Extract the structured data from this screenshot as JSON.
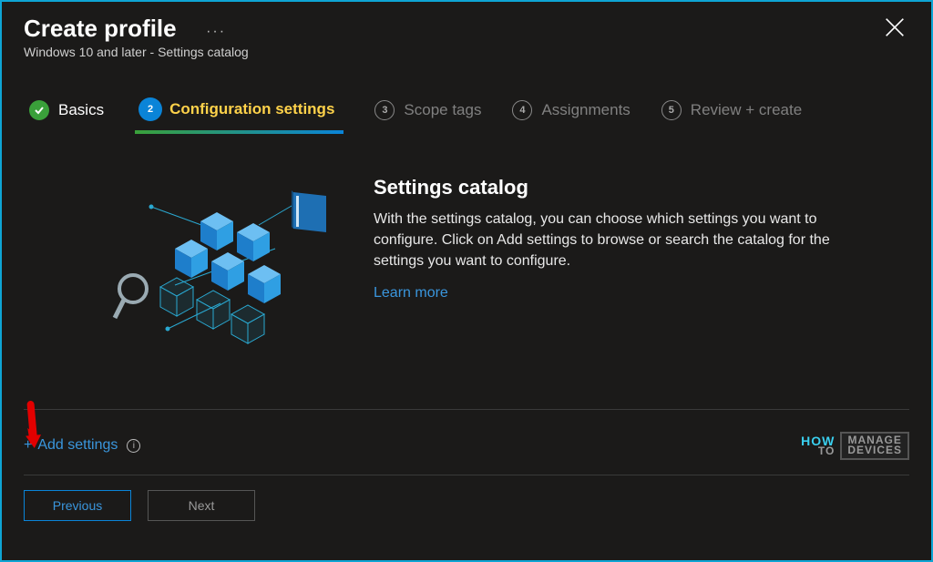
{
  "header": {
    "title": "Create profile",
    "subtitle": "Windows 10 and later - Settings catalog",
    "more": "···"
  },
  "steps": [
    {
      "num": "✓",
      "label": "Basics",
      "state": "done"
    },
    {
      "num": "2",
      "label": "Configuration settings",
      "state": "active"
    },
    {
      "num": "3",
      "label": "Scope tags",
      "state": "pending"
    },
    {
      "num": "4",
      "label": "Assignments",
      "state": "pending"
    },
    {
      "num": "5",
      "label": "Review + create",
      "state": "pending"
    }
  ],
  "info": {
    "title": "Settings catalog",
    "body": "With the settings catalog, you can choose which settings you want to configure. Click on Add settings to browse or search the catalog for the settings you want to configure.",
    "learn_more": "Learn more"
  },
  "add_settings": {
    "plus": "+",
    "label": "Add settings",
    "info_glyph": "i"
  },
  "watermark": {
    "how": "HOW",
    "to": "TO",
    "manage": "MANAGE",
    "devices": "DEVICES"
  },
  "footer": {
    "previous": "Previous",
    "next": "Next"
  }
}
